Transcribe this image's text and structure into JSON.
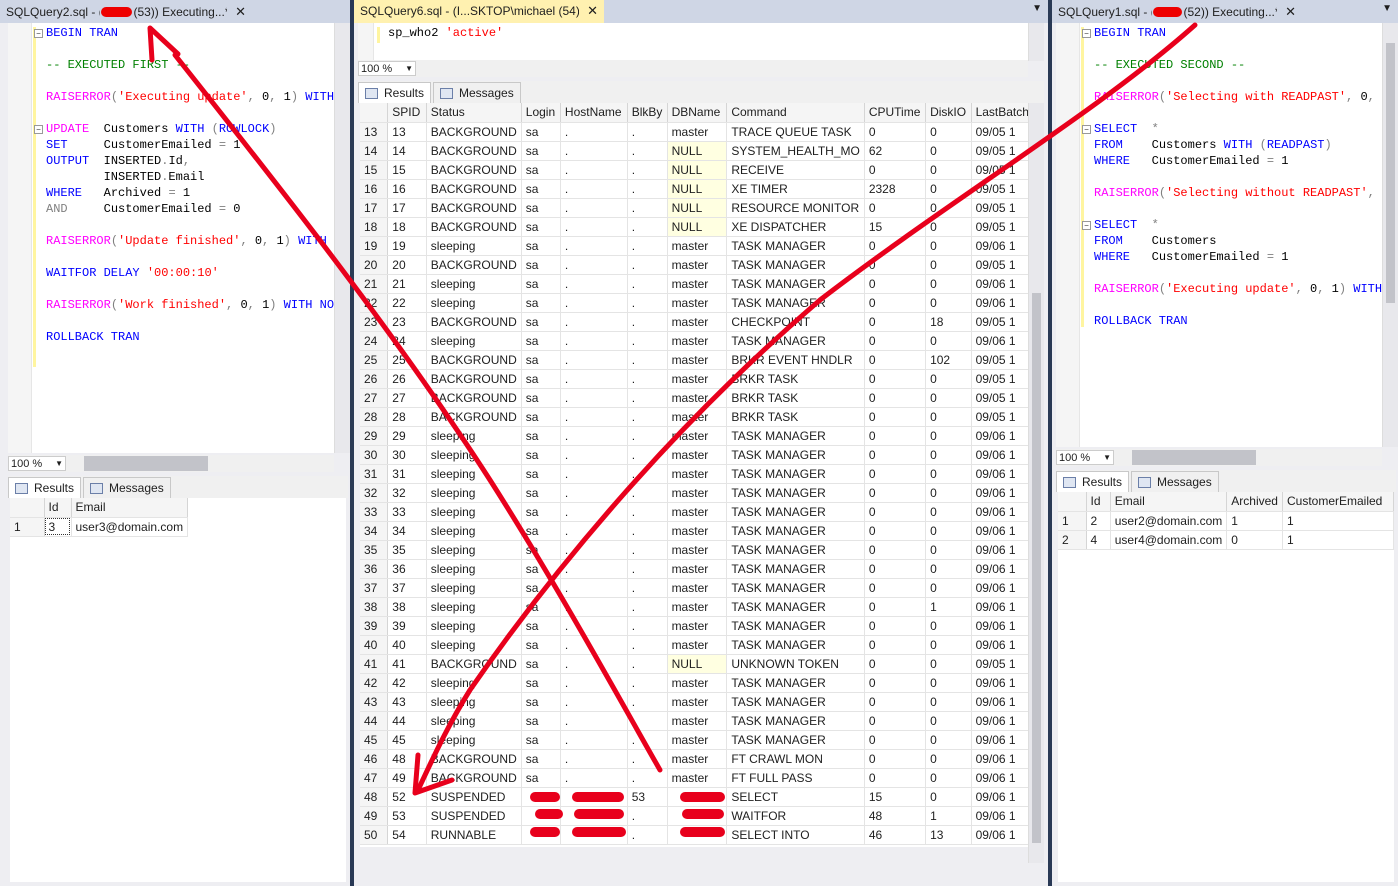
{
  "left": {
    "tab_title": "SQLQuery2.sql - (",
    "tab_title_suffix": "(53)) Executing...*",
    "close": "✕",
    "code": [
      [
        [
          "kw",
          "BEGIN TRAN"
        ]
      ],
      [],
      [
        [
          "cmt",
          "-- EXECUTED FIRST --"
        ]
      ],
      [],
      [
        [
          "pink",
          "RAISERROR"
        ],
        [
          "gray",
          "("
        ],
        [
          "str",
          "'Executing update'"
        ],
        [
          "gray",
          ", "
        ],
        [
          "blk",
          "0"
        ],
        [
          "gray",
          ", "
        ],
        [
          "blk",
          "1"
        ],
        [
          "gray",
          ") "
        ],
        [
          "kw",
          "WITH"
        ]
      ],
      [],
      [
        [
          "pink",
          "UPDATE"
        ],
        [
          "blk",
          "  Customers "
        ],
        [
          "kw",
          "WITH"
        ],
        [
          "gray",
          " ("
        ],
        [
          "kw",
          "ROWLOCK"
        ],
        [
          "gray",
          ")"
        ]
      ],
      [
        [
          "kw",
          "SET"
        ],
        [
          "blk",
          "     CustomerEmailed "
        ],
        [
          "gray",
          "="
        ],
        [
          "blk",
          " 1"
        ]
      ],
      [
        [
          "kw",
          "OUTPUT"
        ],
        [
          "blk",
          "  INSERTED"
        ],
        [
          "gray",
          "."
        ],
        [
          "blk",
          "Id"
        ],
        [
          "gray",
          ","
        ]
      ],
      [
        [
          "blk",
          "        INSERTED"
        ],
        [
          "gray",
          "."
        ],
        [
          "blk",
          "Email"
        ]
      ],
      [
        [
          "kw",
          "WHERE"
        ],
        [
          "blk",
          "   Archived "
        ],
        [
          "gray",
          "="
        ],
        [
          "blk",
          " 1"
        ]
      ],
      [
        [
          "gray",
          "AND"
        ],
        [
          "blk",
          "     CustomerEmailed "
        ],
        [
          "gray",
          "="
        ],
        [
          "blk",
          " 0"
        ]
      ],
      [],
      [
        [
          "pink",
          "RAISERROR"
        ],
        [
          "gray",
          "("
        ],
        [
          "str",
          "'Update finished'"
        ],
        [
          "gray",
          ", "
        ],
        [
          "blk",
          "0"
        ],
        [
          "gray",
          ", "
        ],
        [
          "blk",
          "1"
        ],
        [
          "gray",
          ") "
        ],
        [
          "kw",
          "WITH N"
        ]
      ],
      [],
      [
        [
          "kw",
          "WAITFOR DELAY"
        ],
        [
          "blk",
          " "
        ],
        [
          "str",
          "'00:00:10'"
        ]
      ],
      [],
      [
        [
          "pink",
          "RAISERROR"
        ],
        [
          "gray",
          "("
        ],
        [
          "str",
          "'Work finished'"
        ],
        [
          "gray",
          ", "
        ],
        [
          "blk",
          "0"
        ],
        [
          "gray",
          ", "
        ],
        [
          "blk",
          "1"
        ],
        [
          "gray",
          ") "
        ],
        [
          "kw",
          "WITH NOW"
        ]
      ],
      [],
      [
        [
          "kw",
          "ROLLBACK TRAN"
        ]
      ]
    ],
    "zoom": "100 %",
    "results_tab": "Results",
    "messages_tab": "Messages",
    "columns": [
      "",
      "Id",
      "Email"
    ],
    "rows": [
      [
        "1",
        "3",
        "user3@domain.com"
      ]
    ]
  },
  "middle": {
    "tab_title": "SQLQuery6.sql - (I...SKTOP\\michael (54))*",
    "close": "✕",
    "code": [
      [
        [
          "blk",
          "sp_who2 "
        ],
        [
          "str",
          "'active'"
        ]
      ]
    ],
    "zoom": "100 %",
    "results_tab": "Results",
    "messages_tab": "Messages",
    "columns": [
      "",
      "SPID",
      "Status",
      "Login",
      "HostName",
      "BlkBy",
      "DBName",
      "Command",
      "CPUTime",
      "DiskIO",
      "LastBatch"
    ],
    "rows": [
      [
        "13",
        "13",
        "BACKGROUND",
        "sa",
        ".",
        ".",
        "master",
        "TRACE QUEUE TASK",
        "0",
        "0",
        "09/05 1"
      ],
      [
        "14",
        "14",
        "BACKGROUND",
        "sa",
        ".",
        ".",
        "NULL",
        "SYSTEM_HEALTH_MO",
        "62",
        "0",
        "09/05 1"
      ],
      [
        "15",
        "15",
        "BACKGROUND",
        "sa",
        ".",
        ".",
        "NULL",
        "RECEIVE",
        "0",
        "0",
        "09/05 1"
      ],
      [
        "16",
        "16",
        "BACKGROUND",
        "sa",
        ".",
        ".",
        "NULL",
        "XE TIMER",
        "2328",
        "0",
        "09/05 1"
      ],
      [
        "17",
        "17",
        "BACKGROUND",
        "sa",
        ".",
        ".",
        "NULL",
        "RESOURCE MONITOR",
        "0",
        "0",
        "09/05 1"
      ],
      [
        "18",
        "18",
        "BACKGROUND",
        "sa",
        ".",
        ".",
        "NULL",
        "XE DISPATCHER",
        "15",
        "0",
        "09/05 1"
      ],
      [
        "19",
        "19",
        "sleeping",
        "sa",
        ".",
        ".",
        "master",
        "TASK MANAGER",
        "0",
        "0",
        "09/06 1"
      ],
      [
        "20",
        "20",
        "BACKGROUND",
        "sa",
        ".",
        ".",
        "master",
        "TASK MANAGER",
        "0",
        "0",
        "09/05 1"
      ],
      [
        "21",
        "21",
        "sleeping",
        "sa",
        ".",
        ".",
        "master",
        "TASK MANAGER",
        "0",
        "0",
        "09/06 1"
      ],
      [
        "22",
        "22",
        "sleeping",
        "sa",
        ".",
        ".",
        "master",
        "TASK MANAGER",
        "0",
        "0",
        "09/06 1"
      ],
      [
        "23",
        "23",
        "BACKGROUND",
        "sa",
        ".",
        ".",
        "master",
        "CHECKPOINT",
        "0",
        "18",
        "09/05 1"
      ],
      [
        "24",
        "24",
        "sleeping",
        "sa",
        ".",
        ".",
        "master",
        "TASK MANAGER",
        "0",
        "0",
        "09/06 1"
      ],
      [
        "25",
        "25",
        "BACKGROUND",
        "sa",
        ".",
        ".",
        "master",
        "BRKR EVENT HNDLR",
        "0",
        "102",
        "09/05 1"
      ],
      [
        "26",
        "26",
        "BACKGROUND",
        "sa",
        ".",
        ".",
        "master",
        "BRKR TASK",
        "0",
        "0",
        "09/05 1"
      ],
      [
        "27",
        "27",
        "BACKGROUND",
        "sa",
        ".",
        ".",
        "master",
        "BRKR TASK",
        "0",
        "0",
        "09/05 1"
      ],
      [
        "28",
        "28",
        "BACKGROUND",
        "sa",
        ".",
        ".",
        "master",
        "BRKR TASK",
        "0",
        "0",
        "09/05 1"
      ],
      [
        "29",
        "29",
        "sleeping",
        "sa",
        ".",
        ".",
        "master",
        "TASK MANAGER",
        "0",
        "0",
        "09/06 1"
      ],
      [
        "30",
        "30",
        "sleeping",
        "sa",
        ".",
        ".",
        "master",
        "TASK MANAGER",
        "0",
        "0",
        "09/06 1"
      ],
      [
        "31",
        "31",
        "sleeping",
        "sa",
        ".",
        ".",
        "master",
        "TASK MANAGER",
        "0",
        "0",
        "09/06 1"
      ],
      [
        "32",
        "32",
        "sleeping",
        "sa",
        ".",
        ".",
        "master",
        "TASK MANAGER",
        "0",
        "0",
        "09/06 1"
      ],
      [
        "33",
        "33",
        "sleeping",
        "sa",
        ".",
        ".",
        "master",
        "TASK MANAGER",
        "0",
        "0",
        "09/06 1"
      ],
      [
        "34",
        "34",
        "sleeping",
        "sa",
        ".",
        ".",
        "master",
        "TASK MANAGER",
        "0",
        "0",
        "09/06 1"
      ],
      [
        "35",
        "35",
        "sleeping",
        "sa",
        ".",
        ".",
        "master",
        "TASK MANAGER",
        "0",
        "0",
        "09/06 1"
      ],
      [
        "36",
        "36",
        "sleeping",
        "sa",
        ".",
        ".",
        "master",
        "TASK MANAGER",
        "0",
        "0",
        "09/06 1"
      ],
      [
        "37",
        "37",
        "sleeping",
        "sa",
        ".",
        ".",
        "master",
        "TASK MANAGER",
        "0",
        "0",
        "09/06 1"
      ],
      [
        "38",
        "38",
        "sleeping",
        "sa",
        ".",
        ".",
        "master",
        "TASK MANAGER",
        "0",
        "1",
        "09/06 1"
      ],
      [
        "39",
        "39",
        "sleeping",
        "sa",
        ".",
        ".",
        "master",
        "TASK MANAGER",
        "0",
        "0",
        "09/06 1"
      ],
      [
        "40",
        "40",
        "sleeping",
        "sa",
        ".",
        ".",
        "master",
        "TASK MANAGER",
        "0",
        "0",
        "09/06 1"
      ],
      [
        "41",
        "41",
        "BACKGROUND",
        "sa",
        ".",
        ".",
        "NULL",
        "UNKNOWN TOKEN",
        "0",
        "0",
        "09/05 1"
      ],
      [
        "42",
        "42",
        "sleeping",
        "sa",
        ".",
        ".",
        "master",
        "TASK MANAGER",
        "0",
        "0",
        "09/06 1"
      ],
      [
        "43",
        "43",
        "sleeping",
        "sa",
        ".",
        ".",
        "master",
        "TASK MANAGER",
        "0",
        "0",
        "09/06 1"
      ],
      [
        "44",
        "44",
        "sleeping",
        "sa",
        ".",
        ".",
        "master",
        "TASK MANAGER",
        "0",
        "0",
        "09/06 1"
      ],
      [
        "45",
        "45",
        "sleeping",
        "sa",
        ".",
        ".",
        "master",
        "TASK MANAGER",
        "0",
        "0",
        "09/06 1"
      ],
      [
        "46",
        "48",
        "BACKGROUND",
        "sa",
        ".",
        ".",
        "master",
        "FT CRAWL MON",
        "0",
        "0",
        "09/06 1"
      ],
      [
        "47",
        "49",
        "BACKGROUND",
        "sa",
        ".",
        ".",
        "master",
        "FT FULL PASS",
        "0",
        "0",
        "09/06 1"
      ],
      [
        "48",
        "52",
        "SUSPENDED",
        "",
        "",
        "53",
        "",
        "SELECT",
        "15",
        "0",
        "09/06 1"
      ],
      [
        "49",
        "53",
        "SUSPENDED",
        "",
        "",
        ".",
        "",
        "WAITFOR",
        "48",
        "1",
        "09/06 1"
      ],
      [
        "50",
        "54",
        "RUNNABLE",
        "",
        "",
        ".",
        "",
        "SELECT INTO",
        "46",
        "13",
        "09/06 1"
      ]
    ]
  },
  "right": {
    "tab_title": "SQLQuery1.sql - (",
    "tab_title_suffix": "(52)) Executing...*",
    "close": "✕",
    "code": [
      [
        [
          "kw",
          "BEGIN TRAN"
        ]
      ],
      [],
      [
        [
          "cmt",
          "-- EXECUTED SECOND --"
        ]
      ],
      [],
      [
        [
          "pink",
          "RAISERROR"
        ],
        [
          "gray",
          "("
        ],
        [
          "str",
          "'Selecting with READPAST'"
        ],
        [
          "gray",
          ", "
        ],
        [
          "blk",
          "0"
        ],
        [
          "gray",
          ", "
        ],
        [
          "blk",
          "1"
        ],
        [
          "gray",
          ")"
        ]
      ],
      [],
      [
        [
          "kw",
          "SELECT"
        ],
        [
          "gray",
          "  *"
        ]
      ],
      [
        [
          "kw",
          "FROM"
        ],
        [
          "blk",
          "    Customers "
        ],
        [
          "kw",
          "WITH"
        ],
        [
          "gray",
          " ("
        ],
        [
          "kw",
          "READPAST"
        ],
        [
          "gray",
          ")"
        ]
      ],
      [
        [
          "kw",
          "WHERE"
        ],
        [
          "blk",
          "   CustomerEmailed "
        ],
        [
          "gray",
          "="
        ],
        [
          "blk",
          " 1"
        ]
      ],
      [],
      [
        [
          "pink",
          "RAISERROR"
        ],
        [
          "gray",
          "("
        ],
        [
          "str",
          "'Selecting without READPAST'"
        ],
        [
          "gray",
          ", "
        ],
        [
          "blk",
          "0"
        ],
        [
          "gray",
          ","
        ]
      ],
      [],
      [
        [
          "kw",
          "SELECT"
        ],
        [
          "gray",
          "  *"
        ]
      ],
      [
        [
          "kw",
          "FROM"
        ],
        [
          "blk",
          "    Customers"
        ]
      ],
      [
        [
          "kw",
          "WHERE"
        ],
        [
          "blk",
          "   CustomerEmailed "
        ],
        [
          "gray",
          "="
        ],
        [
          "blk",
          " 1"
        ]
      ],
      [],
      [
        [
          "pink",
          "RAISERROR"
        ],
        [
          "gray",
          "("
        ],
        [
          "str",
          "'Executing update'"
        ],
        [
          "gray",
          ", "
        ],
        [
          "blk",
          "0"
        ],
        [
          "gray",
          ", "
        ],
        [
          "blk",
          "1"
        ],
        [
          "gray",
          ") "
        ],
        [
          "kw",
          "WITH N"
        ]
      ],
      [],
      [
        [
          "kw",
          "ROLLBACK TRAN"
        ]
      ]
    ],
    "zoom": "100 %",
    "results_tab": "Results",
    "messages_tab": "Messages",
    "columns": [
      "",
      "Id",
      "Email",
      "Archived",
      "CustomerEmailed"
    ],
    "rows": [
      [
        "1",
        "2",
        "user2@domain.com",
        "1",
        "1"
      ],
      [
        "2",
        "4",
        "user4@domain.com",
        "0",
        "1"
      ]
    ]
  },
  "colors": {
    "annotation_red": "#e8001c",
    "tab_active": "#fff1b0",
    "tab_inactive": "#cfd6e5",
    "null_cell": "#ffffe1",
    "window_bg": "#293955"
  }
}
